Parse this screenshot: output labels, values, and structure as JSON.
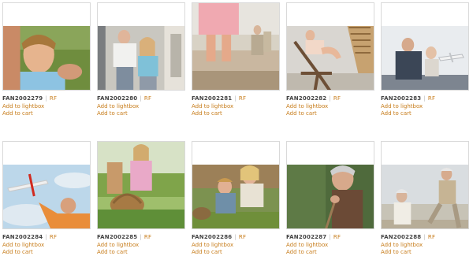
{
  "page": {
    "background": "#ffffff",
    "accent": "#c77c1a"
  },
  "items": [
    {
      "code": "FAN2002279",
      "license": "RF",
      "lightbox": "Add to lightbox",
      "cart": "Add to cart"
    },
    {
      "code": "FAN2002280",
      "license": "RF",
      "lightbox": "Add to lightbox",
      "cart": "Add to cart"
    },
    {
      "code": "FAN2002281",
      "license": "RF",
      "lightbox": "Add to lightbox",
      "cart": "Add to cart"
    },
    {
      "code": "FAN2002282",
      "license": "RF",
      "lightbox": "Add to lightbox",
      "cart": "Add to cart"
    },
    {
      "code": "FAN2002283",
      "license": "RF",
      "lightbox": "Add to lightbox",
      "cart": "Add to cart"
    },
    {
      "code": "FAN2002284",
      "license": "RF",
      "lightbox": "Add to lightbox",
      "cart": "Add to cart"
    },
    {
      "code": "FAN2002285",
      "license": "RF",
      "lightbox": "Add to lightbox",
      "cart": "Add to cart"
    },
    {
      "code": "FAN2002286",
      "license": "RF",
      "lightbox": "Add to lightbox",
      "cart": "Add to cart"
    },
    {
      "code": "FAN2002287",
      "license": "RF",
      "lightbox": "Add to lightbox",
      "cart": "Add to cart"
    },
    {
      "code": "FAN2002288",
      "license": "RF",
      "lightbox": "Add to lightbox",
      "cart": "Add to cart"
    }
  ]
}
